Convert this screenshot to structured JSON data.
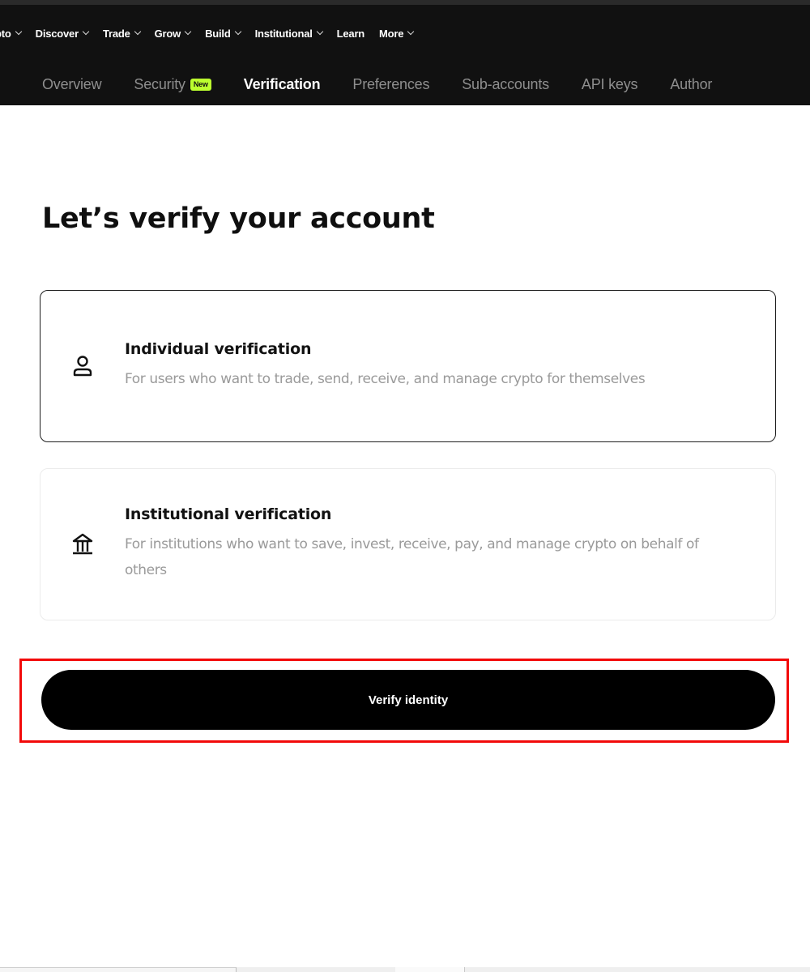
{
  "main_nav": {
    "items": [
      {
        "label": "pto",
        "has_dropdown": true
      },
      {
        "label": "Discover",
        "has_dropdown": true
      },
      {
        "label": "Trade",
        "has_dropdown": true
      },
      {
        "label": "Grow",
        "has_dropdown": true
      },
      {
        "label": "Build",
        "has_dropdown": true
      },
      {
        "label": "Institutional",
        "has_dropdown": true
      },
      {
        "label": "Learn",
        "has_dropdown": false
      },
      {
        "label": "More",
        "has_dropdown": true
      }
    ]
  },
  "sub_nav": {
    "tabs": [
      {
        "label": "Overview",
        "active": false
      },
      {
        "label": "Security",
        "active": false,
        "badge": "New"
      },
      {
        "label": "Verification",
        "active": true
      },
      {
        "label": "Preferences",
        "active": false
      },
      {
        "label": "Sub-accounts",
        "active": false
      },
      {
        "label": "API keys",
        "active": false
      },
      {
        "label": "Author",
        "active": false
      }
    ]
  },
  "page": {
    "title": "Let’s verify your account"
  },
  "options": [
    {
      "icon": "person-icon",
      "title": "Individual verification",
      "description": "For users who want to trade, send, receive, and manage crypto for themselves",
      "selected": true
    },
    {
      "icon": "bank-building-icon",
      "title": "Institutional verification",
      "description": "For institutions who want to save, invest, receive, pay, and manage crypto on behalf of others",
      "selected": false
    }
  ],
  "actions": {
    "verify_label": "Verify identity"
  },
  "colors": {
    "topbar_bg": "#111111",
    "badge_new": "#bcff2f",
    "primary_button": "#000000",
    "highlight_frame": "#f20a0a",
    "muted_text": "#9a9a9a"
  }
}
